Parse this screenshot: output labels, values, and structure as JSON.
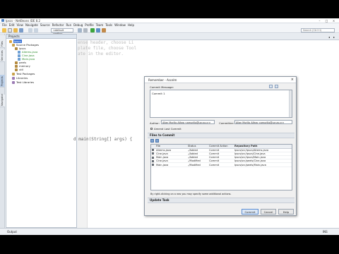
{
  "window": {
    "title": "Ipscs - NetBeans IDE 8.2"
  },
  "menu": [
    "File",
    "Edit",
    "View",
    "Navigate",
    "Source",
    "Refactor",
    "Run",
    "Debug",
    "Profile",
    "Team",
    "Tools",
    "Window",
    "Help"
  ],
  "toolbar": {
    "config": "<default config>",
    "search_placeholder": "Search (Ctrl+I)"
  },
  "sidetabs": [
    "Files",
    "Services",
    "Projects",
    "Navigator"
  ],
  "projects_panel": {
    "title": "Projects",
    "tree": [
      {
        "label": "Ipscs",
        "selected": true
      },
      {
        "label": "Source Packages"
      },
      {
        "label": "ipscs"
      },
      {
        "label": "Aitems.java"
      },
      {
        "label": "Cine.java"
      },
      {
        "label": "Main.java"
      },
      {
        "label": "peels"
      },
      {
        "label": "memory"
      },
      {
        "label": "util"
      },
      {
        "label": "Test Packages"
      },
      {
        "label": "Libraries"
      },
      {
        "label": "Test Libraries"
      }
    ]
  },
  "editor": {
    "lines": [
      "ense header, choose Li",
      "plate file, choose Tool",
      "ate in the editor.",
      "",
      "",
      "",
      "d main(String[] args) {"
    ]
  },
  "statusbar": {
    "output": "Output",
    "mode": "INS"
  },
  "dialog": {
    "title": "Remember - Ascelm",
    "commit_message_label": "Commit Message:",
    "commit_message": "Commit 1",
    "author_label": "Author:",
    "author_value": "Allan Murillo Alfaro <amurillo@ucr.ac.cr>",
    "committer_label": "Committer:",
    "committer_value": "Allan Murillo Alfaro <amurillo@ucr.ac.cr>",
    "amend_label": "Amend Last Commit",
    "files_section": "Files to Commit",
    "columns": [
      "File",
      "Status",
      "Commit Action",
      "Repository Path"
    ],
    "files": [
      {
        "file": "Aitems.java",
        "status": "-/Added",
        "action": "Commit",
        "path": "Ipscs/src/ipscs/Aitems.java"
      },
      {
        "file": "Cine.java",
        "status": "-/Added",
        "action": "Commit",
        "path": "Ipscs/src/ipscs/Cine.java"
      },
      {
        "file": "Main.java",
        "status": "-/Added",
        "action": "Commit",
        "path": "Ipscs/src/ipscs/Main.java"
      },
      {
        "file": "Cine.java",
        "status": "-/Modified",
        "action": "Commit",
        "path": "Ipscs/src/peels/Cine.java"
      },
      {
        "file": "Main.java",
        "status": "-/Modified",
        "action": "Commit",
        "path": "Ipscs/src/peels/Main.java"
      }
    ],
    "hint": "By right-clicking on a row you may specify some additional actions.",
    "update_section": "Update Task",
    "buttons": {
      "commit": "Commit",
      "cancel": "Cancel",
      "help": "Help"
    }
  }
}
